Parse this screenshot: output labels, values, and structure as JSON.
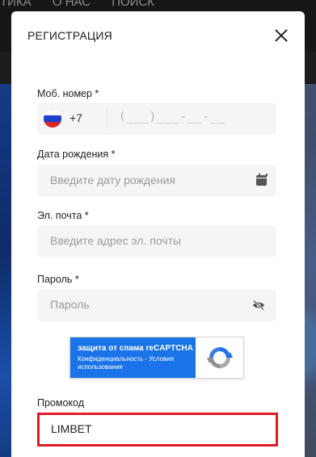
{
  "background": {
    "nav_items": [
      "ТИКА",
      "О НАС",
      "ПОИСК"
    ]
  },
  "modal": {
    "title": "РЕГИСТРАЦИЯ",
    "close_icon": "close-icon"
  },
  "phone": {
    "label": "Моб. номер *",
    "country_code": "+7",
    "flag": "russia-flag-icon",
    "mask": "(___)___-__-__"
  },
  "birthdate": {
    "label": "Дата рождения *",
    "placeholder": "Введите дату рождения",
    "icon": "calendar-icon"
  },
  "email": {
    "label": "Эл. почта *",
    "placeholder": "Введите адрес эл. почты"
  },
  "password": {
    "label": "Пароль *",
    "placeholder": "Пароль",
    "icon": "eye-slash-icon"
  },
  "captcha": {
    "title": "защита от спама reCAPTCHA",
    "links": "Конфиденциальность - Условия использования"
  },
  "promo": {
    "label": "Промокод",
    "value": "LIMBET"
  },
  "colors": {
    "accent_blue": "#1a73e8",
    "highlight_red": "#e21a22"
  }
}
